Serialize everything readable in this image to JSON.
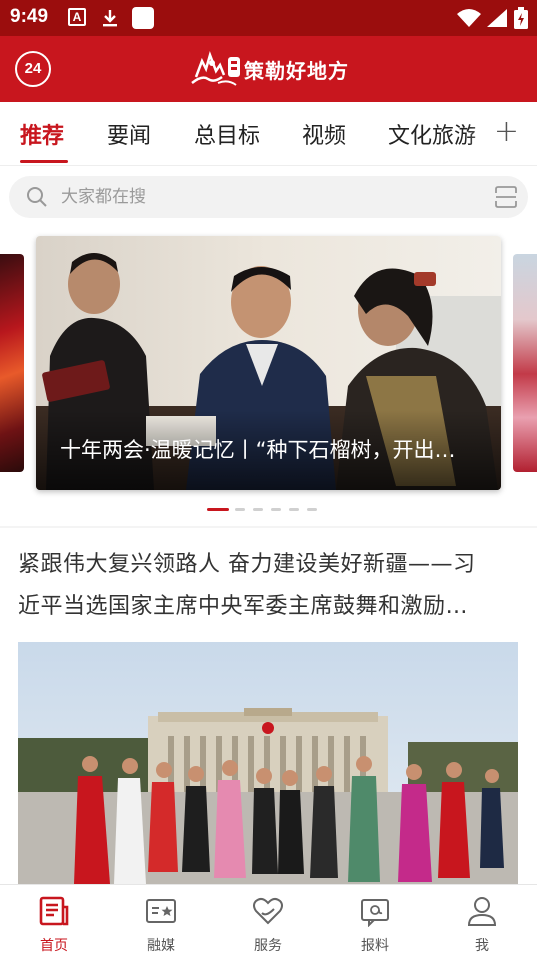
{
  "status_bar": {
    "time": "9:49",
    "icons": [
      "a-notification-icon",
      "download-icon",
      "app-square-icon",
      "wifi-icon",
      "signal-icon",
      "battery-icon"
    ]
  },
  "header": {
    "badge": "24",
    "app_name": "策勒好地方",
    "brand_color": "#c8161e"
  },
  "tabs": [
    {
      "label": "推荐",
      "active": true
    },
    {
      "label": "要闻",
      "active": false
    },
    {
      "label": "总目标",
      "active": false
    },
    {
      "label": "视频",
      "active": false
    },
    {
      "label": "文化旅游",
      "active": false
    }
  ],
  "search": {
    "placeholder": "大家都在搜"
  },
  "carousel": {
    "caption": "十年两会·温暖记忆丨“种下石榴树，开出…",
    "dot_count": 6,
    "active_dot": 1
  },
  "article": {
    "headline_line1": "紧跟伟大复兴领路人 奋力建设美好新疆——习",
    "headline_line2": "近平当选国家主席中央军委主席鼓舞和激励…"
  },
  "bottom_nav": [
    {
      "label": "首页",
      "icon": "home-icon",
      "active": true
    },
    {
      "label": "融媒",
      "icon": "media-icon",
      "active": false
    },
    {
      "label": "服务",
      "icon": "service-icon",
      "active": false
    },
    {
      "label": "报料",
      "icon": "report-icon",
      "active": false
    },
    {
      "label": "我",
      "icon": "profile-icon",
      "active": false
    }
  ]
}
